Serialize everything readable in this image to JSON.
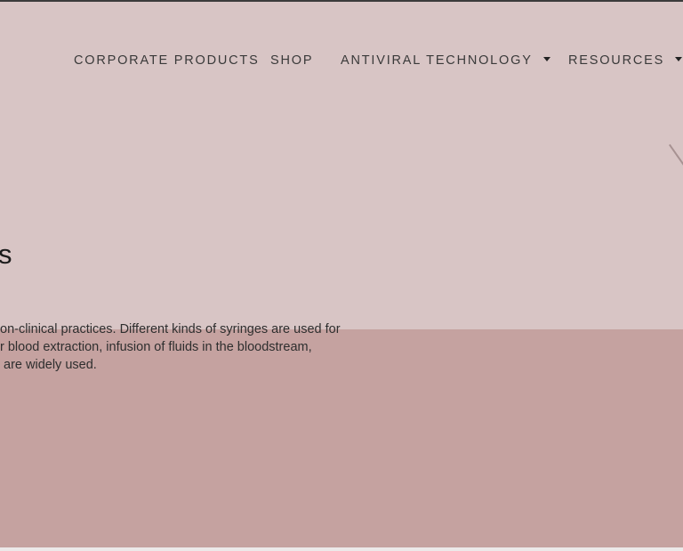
{
  "nav": {
    "items": [
      {
        "label": "CORPORATE PRODUCTS",
        "has_dropdown": false
      },
      {
        "label": "SHOP",
        "has_dropdown": false
      },
      {
        "label": "ANTIVIRAL TECHNOLOGY",
        "has_dropdown": true
      },
      {
        "label": "RESOURCES",
        "has_dropdown": true
      }
    ]
  },
  "hero": {
    "heading_fragment": "s",
    "body_lines": [
      "on-clinical practices. Different kinds of syringes are used for",
      "r blood extraction, infusion of fluids in the bloodstream,",
      " are widely used."
    ]
  },
  "colors": {
    "page_background": "#d8c5c5",
    "lower_block": "#c5a2a0",
    "nav_text": "#3a3a3a"
  }
}
